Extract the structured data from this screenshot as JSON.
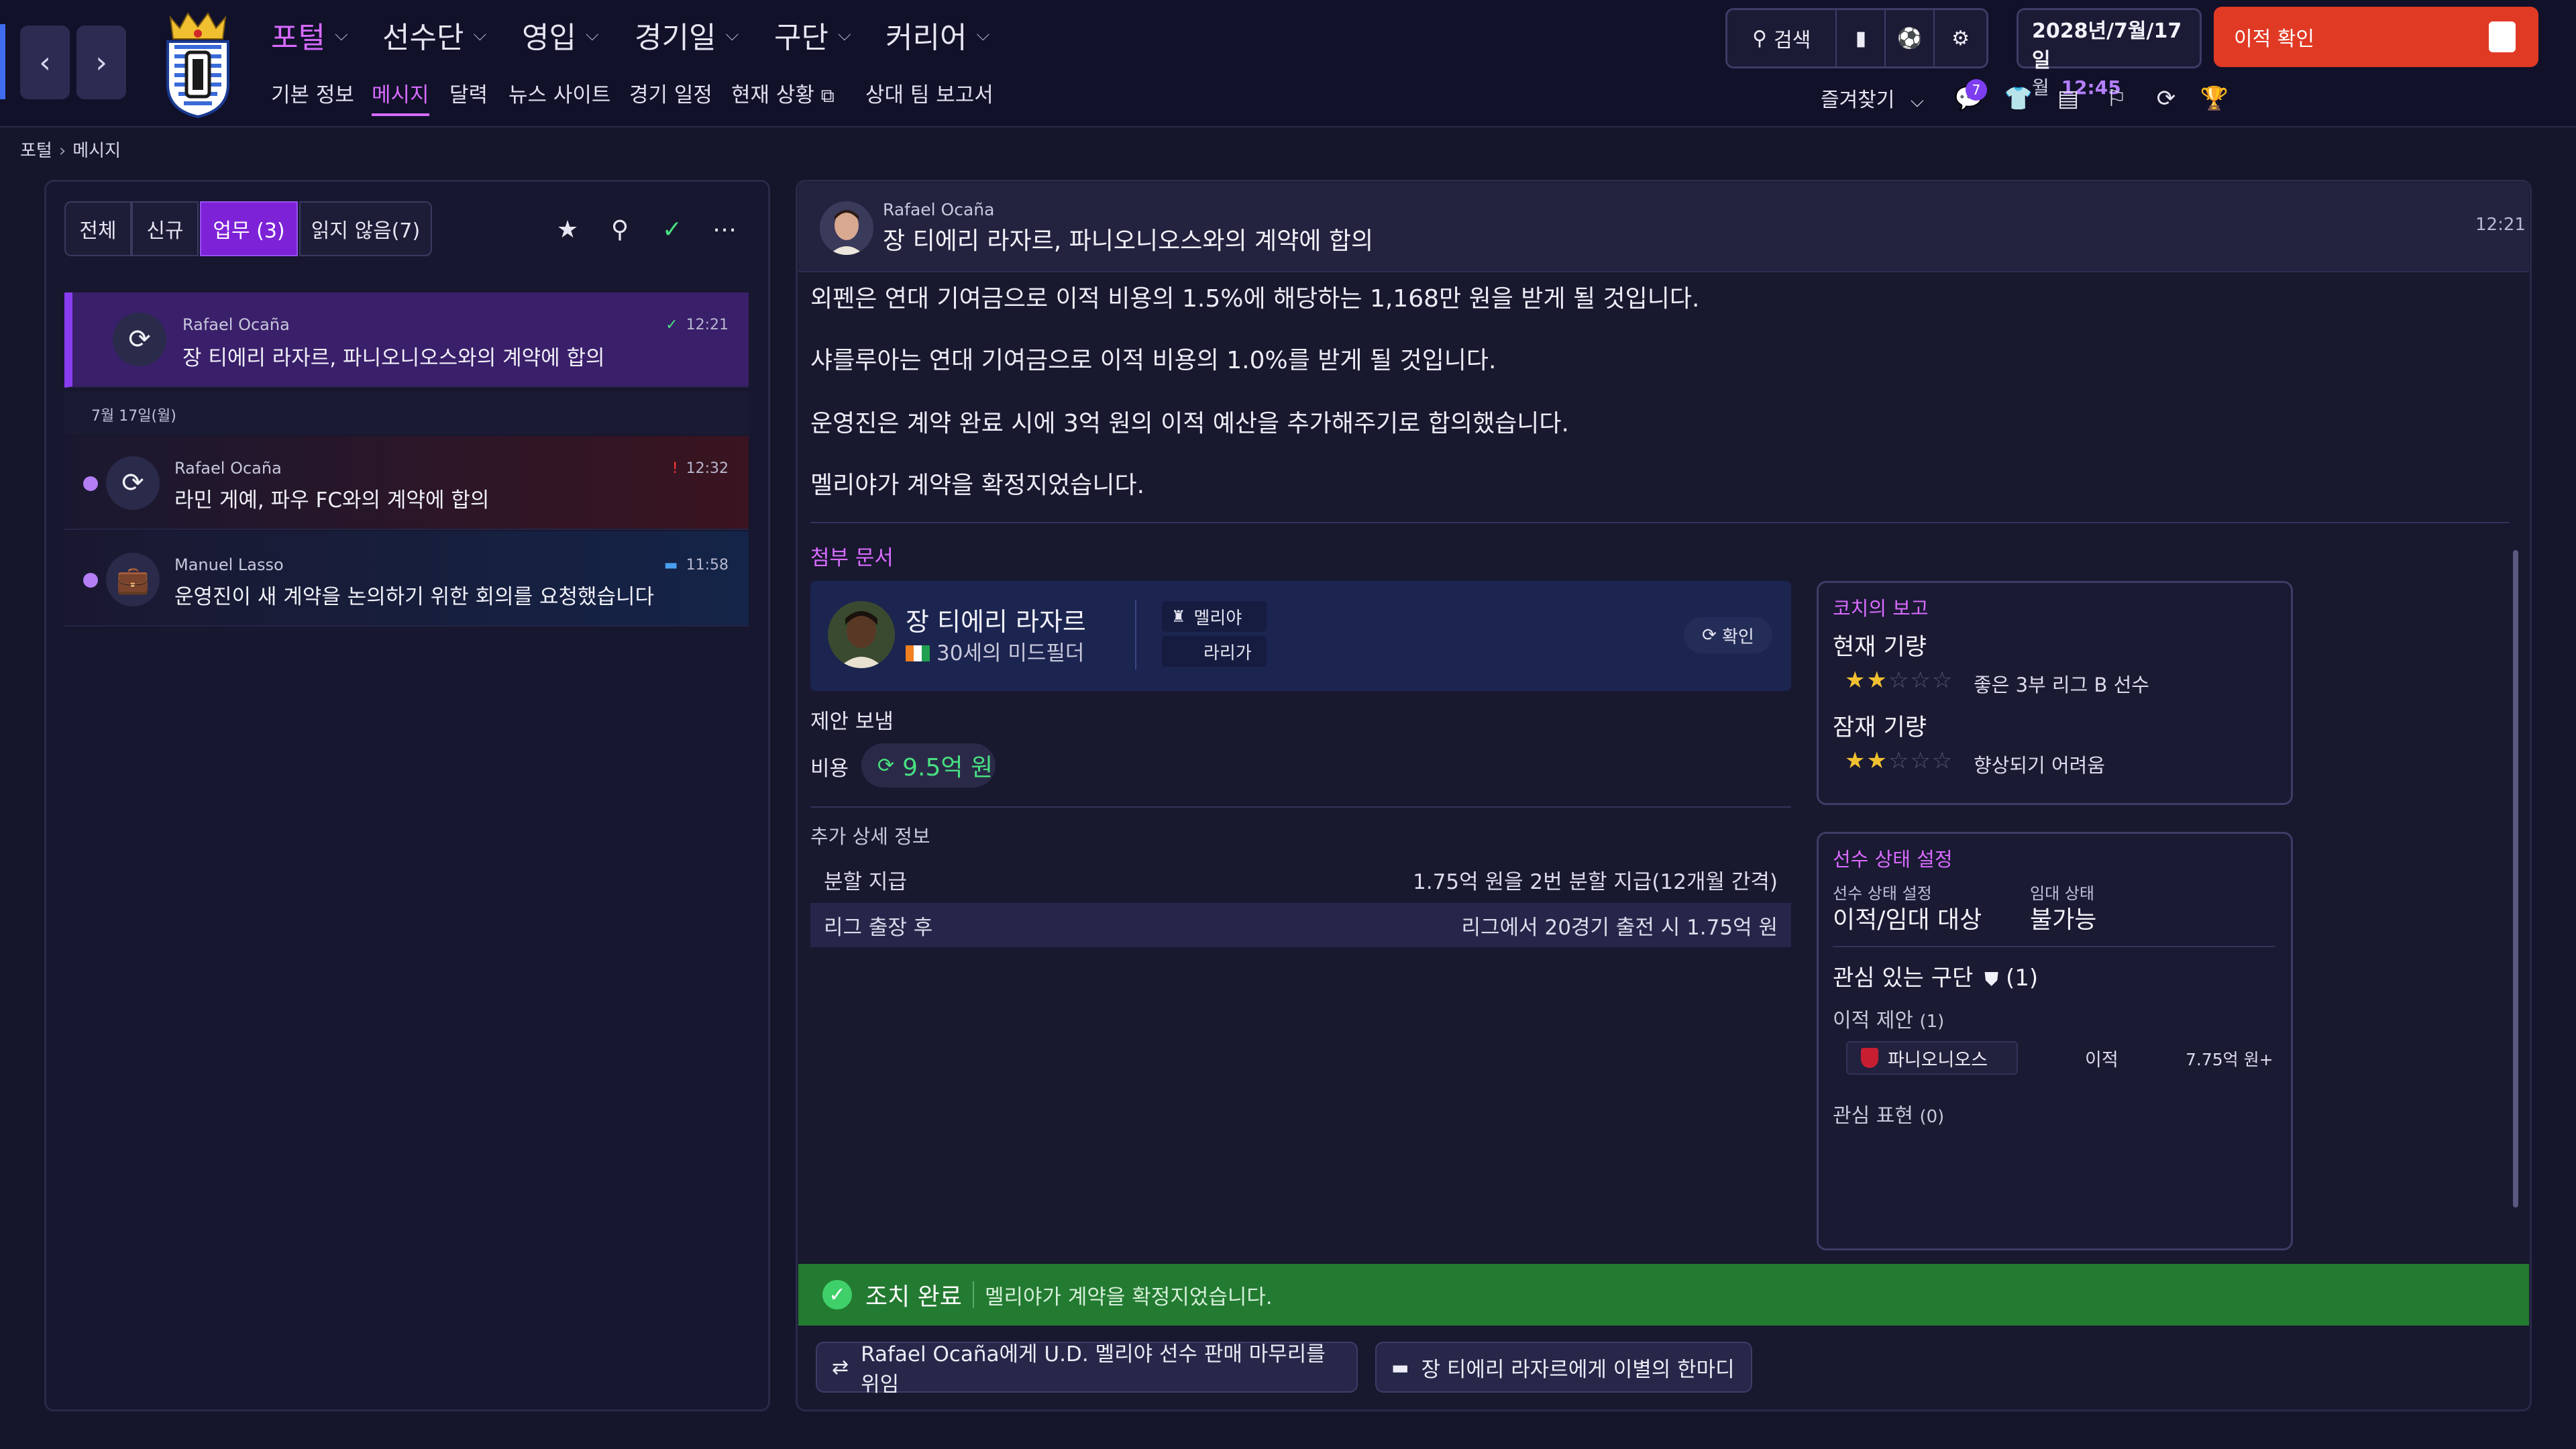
{
  "nav": {
    "back": "‹",
    "forward": "›",
    "main": [
      {
        "label": "포털"
      },
      {
        "label": "선수단"
      },
      {
        "label": "영입"
      },
      {
        "label": "경기일"
      },
      {
        "label": "구단"
      },
      {
        "label": "커리어"
      }
    ],
    "sub": [
      {
        "label": "기본 정보"
      },
      {
        "label": "메시지"
      },
      {
        "label": "달력"
      },
      {
        "label": "뉴스 사이트"
      },
      {
        "label": "경기 일정"
      },
      {
        "label": "현재 상황"
      },
      {
        "label": "상대 팀 보고서"
      }
    ]
  },
  "topright": {
    "search_label": "검색",
    "date_line": "2028년/7월/17일",
    "weekday": "월",
    "time": "12:45",
    "transfer_button": "이적 확인",
    "favorites": "즐겨찾기",
    "notif_count": "7"
  },
  "breadcrumb": {
    "root": "포털",
    "current": "메시지"
  },
  "inbox": {
    "tabs": [
      "전체",
      "신규",
      "업무 (3)",
      "읽지 않음(7)"
    ],
    "date_divider": "7월 17일(월)",
    "messages": [
      {
        "sender": "Rafael Ocaña",
        "subject": "장 티에리 라자르, 파니오니오스와의 계약에 합의",
        "time": "12:21"
      },
      {
        "sender": "Rafael Ocaña",
        "subject": "라민 게예, 파우 FC와의 계약에 합의",
        "time": "12:32"
      },
      {
        "sender": "Manuel Lasso",
        "subject": "운영진이 새 계약을 논의하기 위한 회의를 요청했습니다",
        "time": "11:58"
      }
    ]
  },
  "message": {
    "sender": "Rafael Ocaña",
    "subject": "장 티에리 라자르, 파니오니오스와의 계약에 합의",
    "time": "12:21",
    "paragraphs": [
      "외펜은 연대 기여금으로 이적 비용의 1.5%에 해당하는 1,168만 원을 받게 될 것입니다.",
      "샤를루아는 연대 기여금으로 이적 비용의 1.0%를 받게 될 것입니다.",
      "운영진은 계약 완료 시에 3억 원의 이적 예산을 추가해주기로 합의했습니다.",
      "멜리야가 계약을 확정지었습니다."
    ],
    "attachments_title": "첨부 문서"
  },
  "player": {
    "name": "장 티에리 라자르",
    "desc": "30세의 미드필더",
    "club": "멜리야",
    "league": "라리가",
    "confirm": "확인"
  },
  "offer": {
    "label": "제안 보냄",
    "fee_label": "비용",
    "fee": "9.5억 원",
    "details_title": "추가 상세 정보",
    "rows": [
      {
        "k": "분할 지급",
        "v": "1.75억 원을 2번 분할 지급(12개월 간격)"
      },
      {
        "k": "리그 출장 후",
        "v": "리그에서 20경기 출전 시 1.75억 원"
      }
    ]
  },
  "coach": {
    "title": "코치의 보고",
    "current_label": "현재 기량",
    "current_stars": 2,
    "current_text": "좋은 3부 리그 B 선수",
    "potential_label": "잠재 기량",
    "potential_stars": 2,
    "potential_text": "향상되기 어려움"
  },
  "status": {
    "title": "선수 상태 설정",
    "transfer_label": "선수 상태 설정",
    "transfer_value": "이적/임대 대상",
    "loan_label": "임대 상태",
    "loan_value": "불가능",
    "interested_title": "관심 있는 구단",
    "interested_count": "(1)",
    "offers_label": "이적 제안",
    "offers_count": "(1)",
    "offer_club": "파니오니오스",
    "offer_type": "이적",
    "offer_value": "7.75억 원+",
    "interest_label": "관심 표현",
    "interest_count": "(0)"
  },
  "action": {
    "done": "조치 완료",
    "text": "멜리야가 계약을 확정지었습니다."
  },
  "footer": {
    "btn1": "Rafael Ocaña에게 U.D. 멜리야 선수 판매 마무리를 위임",
    "btn2": "장 티에리 라자르에게 이별의 한마디"
  },
  "colors": {
    "accent": "#d86bff",
    "tab_active": "#7d22d6",
    "success": "#237a31",
    "transfer": "#e03a25"
  }
}
